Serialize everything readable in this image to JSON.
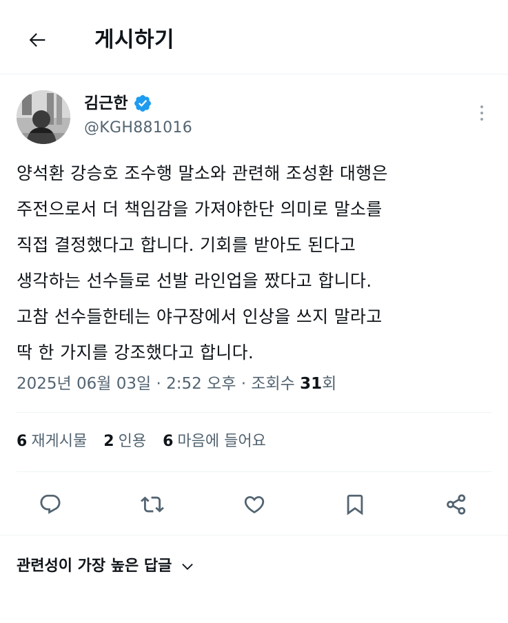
{
  "header": {
    "title": "게시하기",
    "back_icon": "arrow-left-icon"
  },
  "author": {
    "display_name": "김근한",
    "handle": "@KGH881016",
    "verified": true,
    "verified_color": "#1d9bf0"
  },
  "tweet": {
    "lines": [
      "양석환 강승호 조수행 말소와 관련해 조성환 대행은",
      "주전으로서 더 책임감을 가져야한단 의미로 말소를",
      "직접 결정했다고 합니다. 기회를 받아도 된다고",
      "생각하는 선수들로 선발 라인업을 짰다고 합니다.",
      "고참 선수들한테는 야구장에서 인상을 쓰지 말라고",
      "딱 한 가지를 강조했다고 합니다."
    ]
  },
  "meta": {
    "date": "2025년 06월 03일",
    "time": "2:52 오후",
    "views_label": "조회수",
    "views_count": "31",
    "views_unit": "회",
    "separator": "·"
  },
  "stats": {
    "reposts_count": "6",
    "reposts_label": "재게시물",
    "quotes_count": "2",
    "quotes_label": "인용",
    "likes_count": "6",
    "likes_label": "마음에 들어요"
  },
  "actions": [
    "reply-icon",
    "repost-icon",
    "like-icon",
    "bookmark-icon",
    "share-icon"
  ],
  "replies_sort": {
    "label": "관련성이 가장 높은 답글",
    "icon": "chevron-down-icon"
  },
  "colors": {
    "text": "#0f1419",
    "secondary": "#536471",
    "divider": "#eff3f4",
    "icon": "#536471"
  }
}
